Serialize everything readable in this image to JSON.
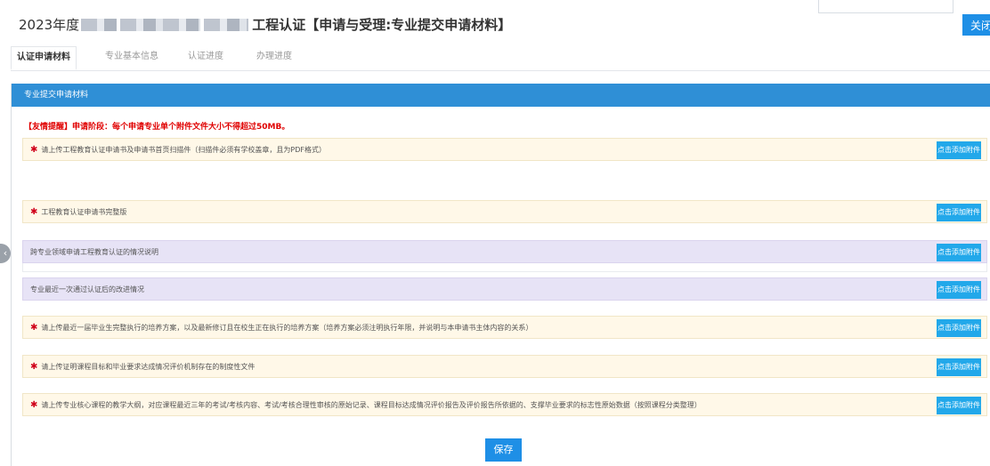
{
  "header": {
    "title_prefix": "2023年度",
    "title_suffix": "工程认证【申请与受理:专业提交申请材料】",
    "close_label": "关闭"
  },
  "tabs": [
    {
      "label": "认证申请材料",
      "active": true
    },
    {
      "label": "专业基本信息",
      "active": false
    },
    {
      "label": "认证进度",
      "active": false
    },
    {
      "label": "办理进度",
      "active": false
    }
  ],
  "panel": {
    "title": "专业提交申请材料",
    "notice": "【友情提醒】申请阶段：每个申请专业单个附件文件大小不得超过50MB。"
  },
  "rows": [
    {
      "label": "请上传工程教育认证申请书及申请书首页扫描件（扫描件必须有学校盖章，且为PDF格式）",
      "required": true
    },
    {
      "label": "工程教育认证申请书完整版",
      "required": true
    },
    {
      "label": "跨专业领域申请工程教育认证的情况说明",
      "required": false
    },
    {
      "label": "专业最近一次通过认证后的改进情况",
      "required": false
    },
    {
      "label": "请上传最近一届毕业生完整执行的培养方案，以及最新修订且在校生正在执行的培养方案（培养方案必须注明执行年限，并说明与本申请书主体内容的关系）",
      "required": true
    },
    {
      "label": "请上传证明课程目标和毕业要求达成情况评价机制存在的制度性文件",
      "required": true
    },
    {
      "label": "请上传专业核心课程的教学大纲，对应课程最近三年的考试/考核内容、考试/考核合理性审核的原始记录、课程目标达成情况评价报告及评价报告所依据的、支撑毕业要求的标志性原始数据（按照课程分类整理）",
      "required": true
    }
  ],
  "add_label": "点击添加附件",
  "star_symbol": "✱",
  "delete_symbol": "✖",
  "handle_symbol": "‹",
  "save_label": "保存",
  "colors": {
    "primary": "#1e8fe6",
    "panel_header": "#2f8fd6",
    "add_button": "#22a8ea",
    "notice": "#e00000",
    "required_row": "#fff8e8",
    "optional_row": "#e7e3f6"
  }
}
